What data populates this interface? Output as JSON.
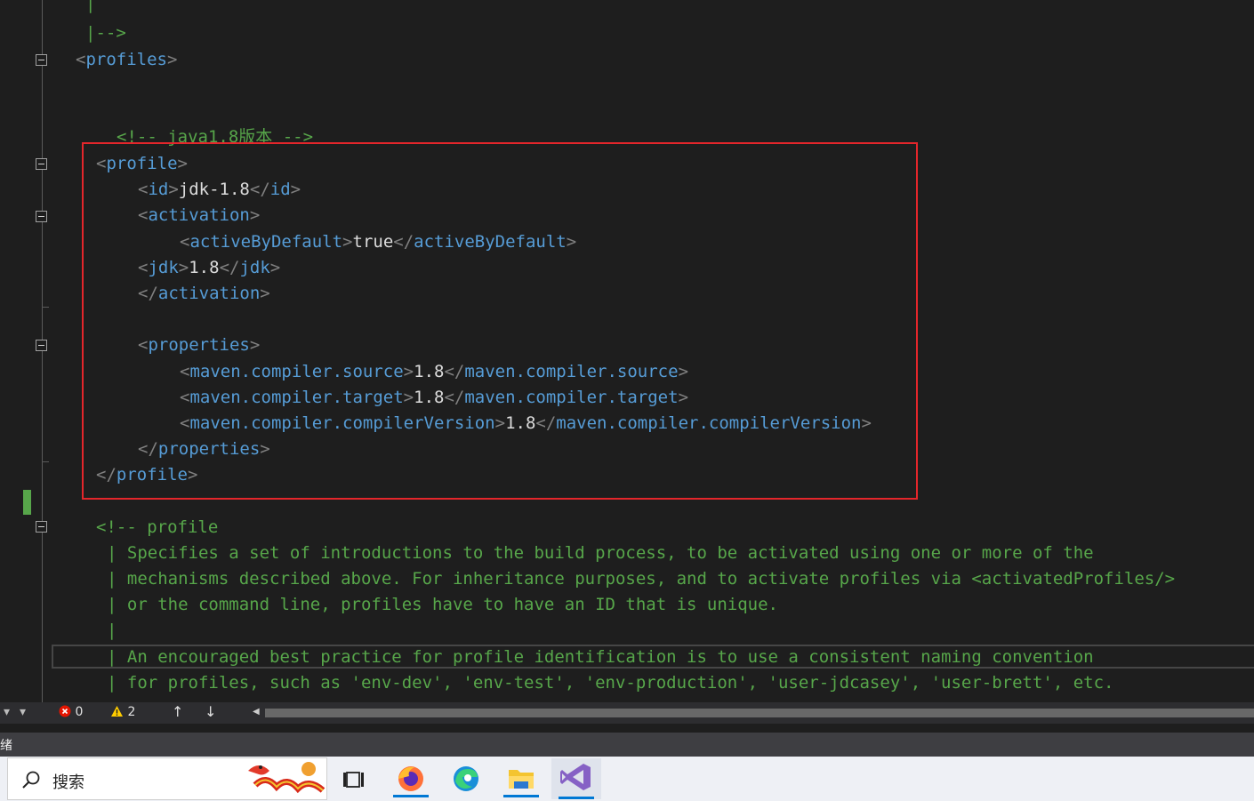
{
  "editor": {
    "comment_end": "|-->",
    "profiles_tag": "profiles",
    "java_comment": "<!-- java1.8版本 -->",
    "profile_tag": "profile",
    "id_tag": "id",
    "id_value": "jdk-1.8",
    "activation_tag": "activation",
    "active_by_default_tag": "activeByDefault",
    "active_by_default_value": "true",
    "jdk_tag": "jdk",
    "jdk_value": "1.8",
    "properties_tag": "properties",
    "source_tag": "maven.compiler.source",
    "source_value": "1.8",
    "target_tag": "maven.compiler.target",
    "target_value": "1.8",
    "compiler_version_tag": "maven.compiler.compilerVersion",
    "compiler_version_value": "1.8",
    "comment_profile_head": "<!-- profile",
    "comment_lines": [
      "Specifies a set of introductions to the build process, to be activated using one or more of the",
      "mechanisms described above. For inheritance purposes, and to activate profiles via <activatedProfiles/>",
      "or the command line, profiles have to have an ID that is unique.",
      "",
      "An encouraged best practice for profile identification is to use a consistent naming convention",
      "for profiles, such as 'env-dev', 'env-test', 'env-production', 'user-jdcasey', 'user-brett', etc."
    ]
  },
  "error_bar": {
    "errors": "0",
    "warnings": "2"
  },
  "status": {
    "text": "绪"
  },
  "taskbar": {
    "search_placeholder": "搜索"
  },
  "colors": {
    "highlight": "#e3262b",
    "tag": "#569cd6",
    "comment": "#57a64a",
    "taskbar_accent": "#0078d4"
  }
}
